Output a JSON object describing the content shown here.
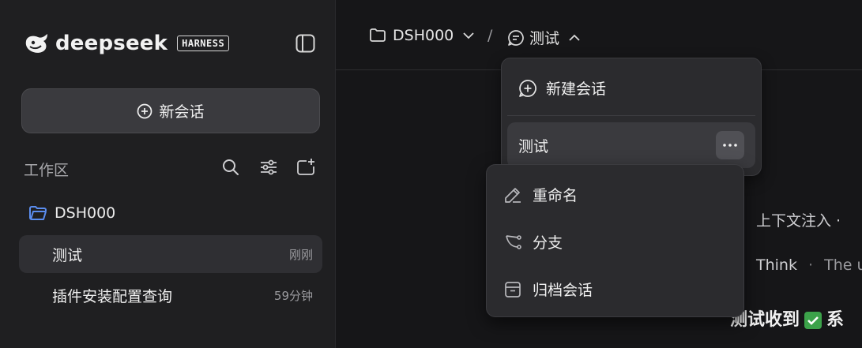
{
  "sidebar": {
    "brand": "deepseek",
    "badge": "HARNESS",
    "new_chat_label": "新会话",
    "workspace_label": "工作区",
    "folder_name": "DSH000",
    "conversations": [
      {
        "title": "测试",
        "time": "刚刚",
        "active": true
      },
      {
        "title": "插件安装配置查询",
        "time": "59分钟",
        "active": false
      }
    ]
  },
  "breadcrumb": {
    "project": "DSH000",
    "separator": "/",
    "conversation": "测试"
  },
  "conversation_menu": {
    "new_label": "新建会话",
    "current_label": "测试"
  },
  "context_menu": {
    "items": [
      {
        "label": "重命名",
        "icon": "pencil-icon"
      },
      {
        "label": "分支",
        "icon": "branch-icon"
      },
      {
        "label": "归档会话",
        "icon": "archive-icon"
      }
    ]
  },
  "background": {
    "line1": "上下文注入 ·",
    "line2_think": "Think",
    "line2_dot": "·",
    "line2_rest": "The us",
    "line3_a": "测试收到",
    "line3_b": "系"
  },
  "colors": {
    "folder_icon": "#5b8def",
    "check_green": "#3ca24a",
    "accent_bg": "#3a3a3e"
  }
}
